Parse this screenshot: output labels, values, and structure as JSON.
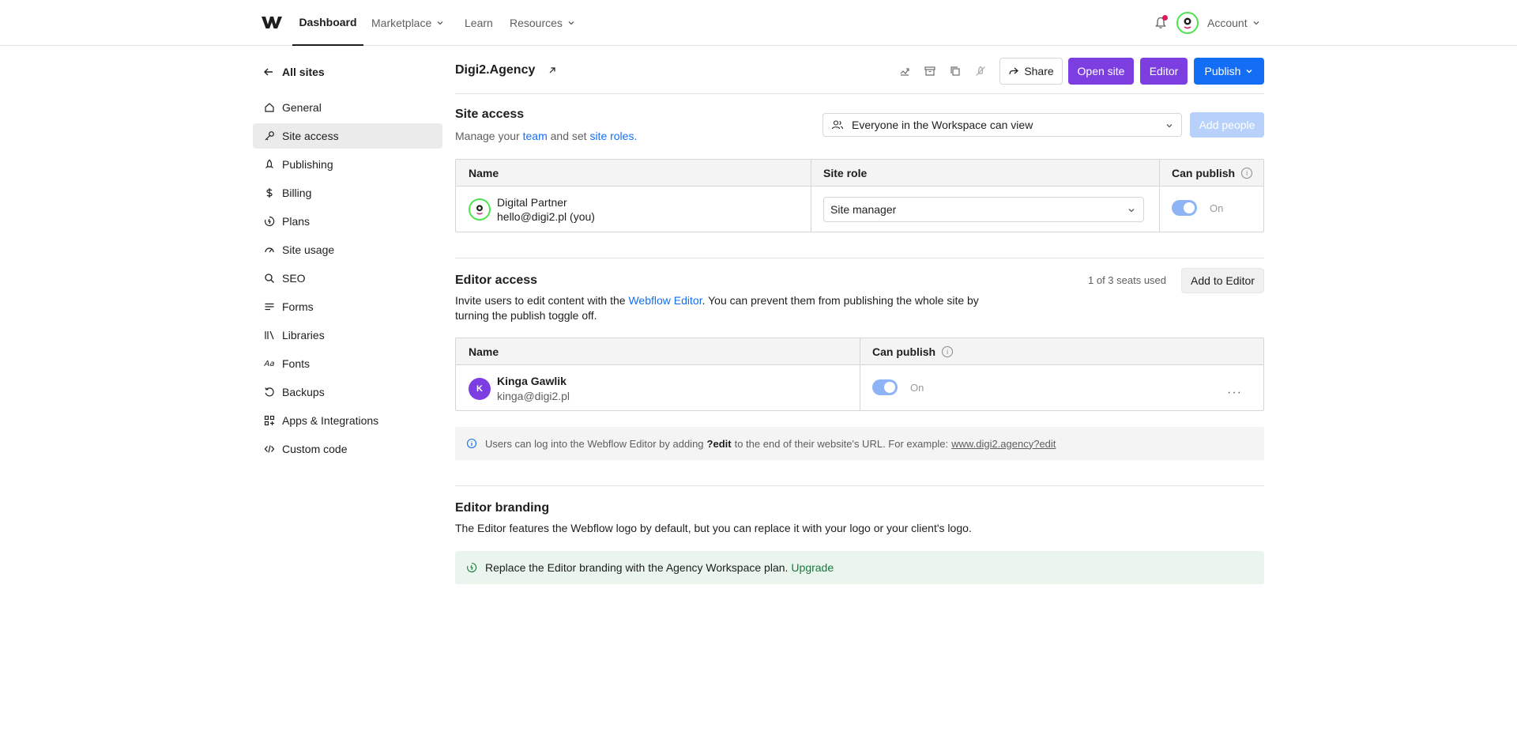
{
  "nav": {
    "tabs": [
      {
        "label": "Dashboard"
      },
      {
        "label": "Marketplace"
      },
      {
        "label": "Learn"
      },
      {
        "label": "Resources"
      }
    ],
    "account_label": "Account"
  },
  "sidebar": {
    "back_label": "All sites",
    "items": [
      {
        "label": "General",
        "icon": "home-icon"
      },
      {
        "label": "Site access",
        "icon": "key-icon"
      },
      {
        "label": "Publishing",
        "icon": "rocket-icon"
      },
      {
        "label": "Billing",
        "icon": "dollar-icon"
      },
      {
        "label": "Plans",
        "icon": "plans-icon"
      },
      {
        "label": "Site usage",
        "icon": "gauge-icon"
      },
      {
        "label": "SEO",
        "icon": "search-icon"
      },
      {
        "label": "Forms",
        "icon": "forms-icon"
      },
      {
        "label": "Libraries",
        "icon": "libraries-icon"
      },
      {
        "label": "Fonts",
        "icon": "fonts-icon"
      },
      {
        "label": "Backups",
        "icon": "backup-icon"
      },
      {
        "label": "Apps & Integrations",
        "icon": "apps-icon"
      },
      {
        "label": "Custom code",
        "icon": "code-icon"
      }
    ],
    "active": "Site access"
  },
  "header": {
    "site_name": "Digi2.Agency",
    "share_label": "Share",
    "open_site_label": "Open site",
    "editor_label": "Editor",
    "publish_label": "Publish"
  },
  "site_access": {
    "title": "Site access",
    "desc_prefix": "Manage your ",
    "desc_team": "team",
    "desc_mid": " and set ",
    "desc_roles": "site roles",
    "desc_suffix": ".",
    "workspace_select": "Everyone in the Workspace can view",
    "add_people_label": "Add people",
    "columns": [
      "Name",
      "Site role",
      "Can publish"
    ],
    "member": {
      "name": "Digital Partner",
      "email": "hello@digi2.pl (you)",
      "role": "Site manager",
      "publish_state": "On"
    }
  },
  "editor_access": {
    "title": "Editor access",
    "seats": "1 of 3 seats used",
    "add_label": "Add to Editor",
    "desc_prefix": "Invite users to edit content with the ",
    "desc_link": "Webflow Editor",
    "desc_line1_suffix": ". You can prevent them from publishing the whole site by",
    "desc_line2": "turning the publish toggle off.",
    "columns": [
      "Name",
      "Can publish"
    ],
    "user": {
      "initial": "K",
      "name": "Kinga Gawlik",
      "email": "kinga@digi2.pl",
      "publish_state": "On"
    },
    "note_prefix": "Users can log into the Webflow Editor by adding ",
    "note_code": "?edit",
    "note_mid": " to the end of their website's URL. For example: ",
    "note_url": "www.digi2.agency?edit"
  },
  "editor_branding": {
    "title": "Editor branding",
    "desc": "The Editor features the Webflow logo by default, but you can replace it with your logo or your client's logo.",
    "note": "Replace the Editor branding with the Agency Workspace plan.",
    "upgrade_label": "Upgrade"
  },
  "colors": {
    "accent_purple": "#7c3ee0",
    "accent_blue": "#146ef5",
    "success_green": "#167a3c"
  }
}
